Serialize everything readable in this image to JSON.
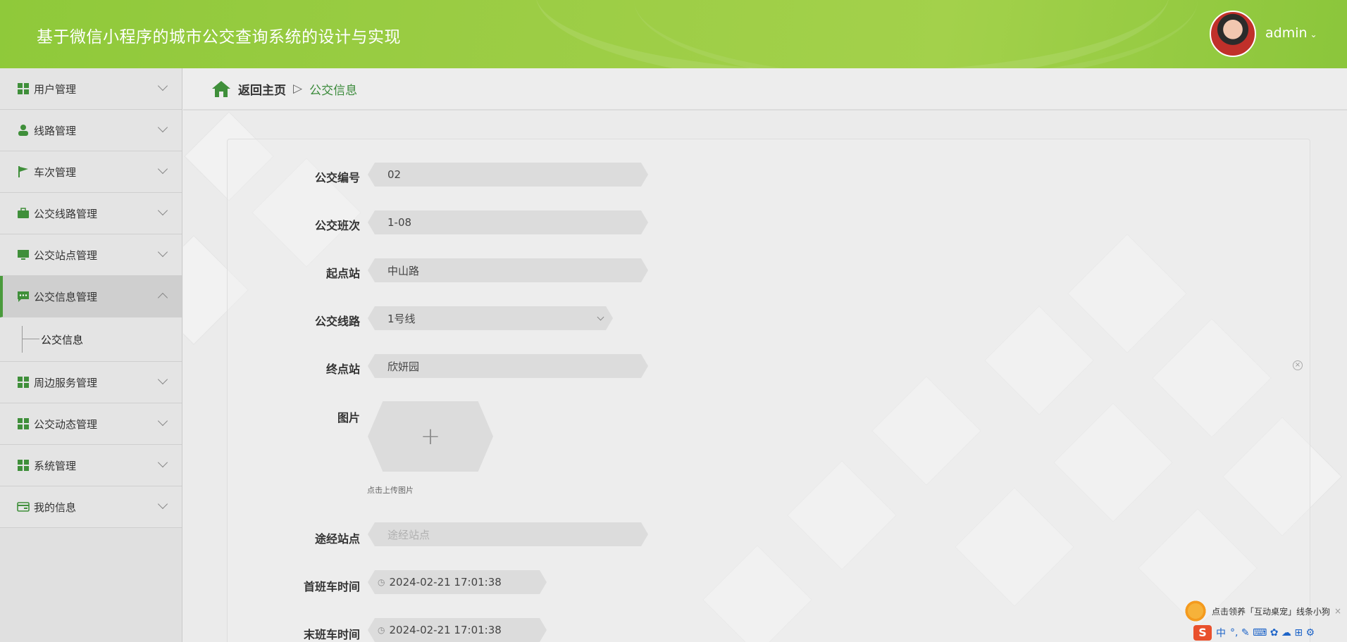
{
  "header": {
    "title": "基于微信小程序的城市公交查询系统的设计与实现",
    "username": "admin",
    "caret": "⌄"
  },
  "sidebar": {
    "items": [
      {
        "label": "用户管理",
        "icon": "grid-icon"
      },
      {
        "label": "线路管理",
        "icon": "user-icon"
      },
      {
        "label": "车次管理",
        "icon": "flag-icon"
      },
      {
        "label": "公交线路管理",
        "icon": "briefcase-icon"
      },
      {
        "label": "公交站点管理",
        "icon": "monitor-icon"
      },
      {
        "label": "公交信息管理",
        "icon": "chat-icon",
        "active": true
      },
      {
        "label": "周边服务管理",
        "icon": "grid-icon"
      },
      {
        "label": "公交动态管理",
        "icon": "grid-icon"
      },
      {
        "label": "系统管理",
        "icon": "grid-icon"
      },
      {
        "label": "我的信息",
        "icon": "card-icon"
      }
    ],
    "submenu": {
      "label": "公交信息"
    }
  },
  "breadcrumb": {
    "home": "返回主页",
    "separator": "▷",
    "current": "公交信息"
  },
  "form": {
    "bus_number": {
      "label": "公交编号",
      "value": "02"
    },
    "bus_shift": {
      "label": "公交班次",
      "value": "1-08"
    },
    "start_station": {
      "label": "起点站",
      "value": "中山路"
    },
    "bus_route": {
      "label": "公交线路",
      "value": "1号线"
    },
    "end_station": {
      "label": "终点站",
      "value": "欣妍园"
    },
    "image": {
      "label": "图片",
      "upload_symbol": "+",
      "hint": "点击上传图片"
    },
    "via_stations": {
      "label": "途经站点",
      "placeholder": "途经站点"
    },
    "first_bus_time": {
      "label": "首班车时间",
      "value": "2024-02-21 17:01:38"
    },
    "last_bus_time": {
      "label": "末班车时间",
      "value": "2024-02-21 17:01:38"
    }
  },
  "overlay": {
    "pet_banner": "点击领养「互动桌宠」线条小狗",
    "close": "×",
    "ime_logo": "S",
    "ime_mode": "中",
    "ime_symbols": "°, ✎ ⌨ ✿ ☁ ⊞ ⚙"
  },
  "colors": {
    "header_green": "#9ccd45",
    "accent_green": "#3f8f3a",
    "active_border": "#4a9a3c"
  }
}
